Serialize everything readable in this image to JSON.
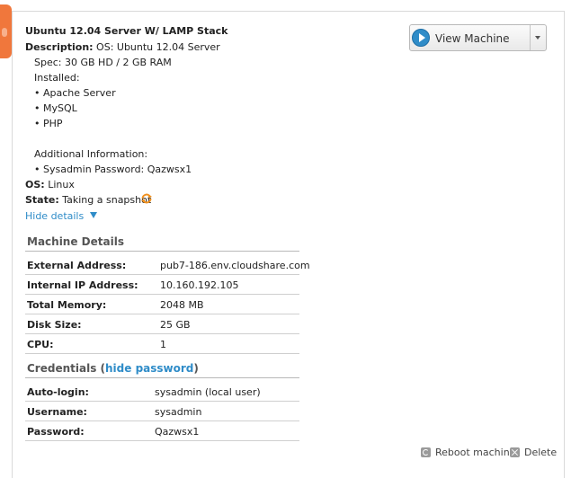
{
  "machine": {
    "title": "Ubuntu 12.04 Server W/ LAMP Stack",
    "description_label": "Description:",
    "description_first": "OS: Ubuntu 12.04 Server",
    "description_lines": [
      "Spec: 30 GB HD / 2 GB RAM",
      "Installed:",
      "• Apache Server",
      "• MySQL",
      "• PHP",
      "",
      "Additional Information:",
      "• Sysadmin Password: Qazwsx1"
    ],
    "os_label": "OS:",
    "os_value": "Linux",
    "state_label": "State:",
    "state_value": "Taking a snapshot",
    "hide_details": "Hide details"
  },
  "view_button": {
    "label": "View Machine"
  },
  "machine_details": {
    "title": "Machine Details",
    "rows": [
      {
        "key": "External Address:",
        "value": "pub7-186.env.cloudshare.com"
      },
      {
        "key": "Internal IP Address:",
        "value": "10.160.192.105"
      },
      {
        "key": "Total Memory:",
        "value": "2048 MB"
      },
      {
        "key": "Disk Size:",
        "value": "25 GB"
      },
      {
        "key": "CPU:",
        "value": "1"
      }
    ]
  },
  "credentials": {
    "title": "Credentials",
    "open_paren": "(",
    "hide_password": "hide password",
    "close_paren": ")",
    "rows": [
      {
        "key": "Auto-login:",
        "value": "sysadmin (local user)"
      },
      {
        "key": "Username:",
        "value": "sysadmin"
      },
      {
        "key": "Password:",
        "value": "Qazwsx1"
      }
    ]
  },
  "actions": {
    "reboot": "Reboot machine",
    "delete": "Delete"
  },
  "colors": {
    "accent": "#2f8cc8",
    "tab": "#f0773c",
    "state_icon": "#f0901e"
  }
}
